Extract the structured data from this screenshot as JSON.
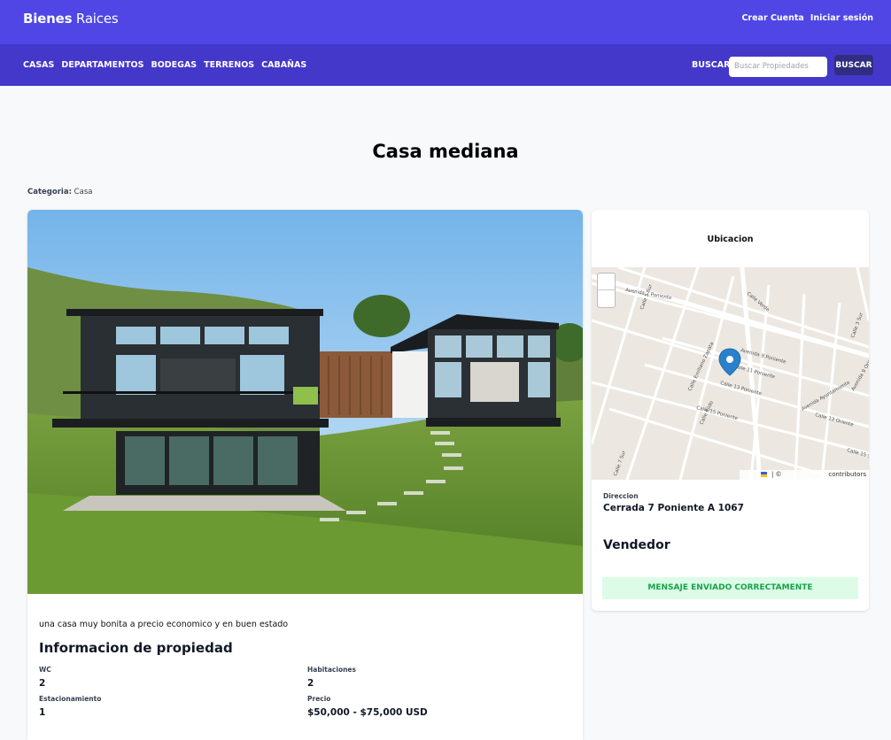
{
  "header": {
    "brand_bold": "Bienes",
    "brand_light": "Raices",
    "create_account": "Crear Cuenta",
    "login": "Iniciar sesión"
  },
  "nav": {
    "links": [
      "CASAS",
      "DEPARTAMENTOS",
      "BODEGAS",
      "TERRENOS",
      "CABAÑAS"
    ],
    "search_label": "BUSCAR",
    "search_placeholder": "Buscar Propiedades",
    "search_button": "BUSCAR"
  },
  "property": {
    "title": "Casa mediana",
    "category_label": "Categoria:",
    "category_value": "Casa",
    "description": "una casa muy bonita a precio economico y en buen estado",
    "info_title": "Informacion de propiedad",
    "info": {
      "wc_label": "WC",
      "wc_value": "2",
      "rooms_label": "Habitaciones",
      "rooms_value": "2",
      "parking_label": "Estacionamiento",
      "parking_value": "1",
      "price_label": "Precio",
      "price_value": "$50,000 - $75,000 USD"
    }
  },
  "sidebar": {
    "location_title": "Ubicacion",
    "address_label": "Direccion",
    "address_value": "Cerrada 7 Poniente A 1067",
    "seller_title": "Vendedor",
    "success_message": "MENSAJE ENVIADO CORRECTAMENTE",
    "map": {
      "streets": [
        "Avenida 7 Poniente",
        "Calle 5 Sur",
        "Calle Verde",
        "Avenida 9 Poniente",
        "Calle 11 Poniente",
        "Calle 13 Poniente",
        "Calle 15 Poniente",
        "Calle Emiliano Zapata",
        "Calle Ejido",
        "Calle 13 Oriente",
        "Avenida Ayuntamiento",
        "Calle 15 Sur",
        "Calle 7 Sur",
        "Calle 3 Sur",
        "Avenida 9 Oriente"
      ],
      "attribution_copy": "| ©",
      "attribution_contrib": "contributors"
    }
  },
  "colors": {
    "topbar": "#4f46e5",
    "navbar": "#4338ca",
    "search_button": "#312e81",
    "success_bg": "#dcfce7",
    "success_text": "#16a34a"
  }
}
